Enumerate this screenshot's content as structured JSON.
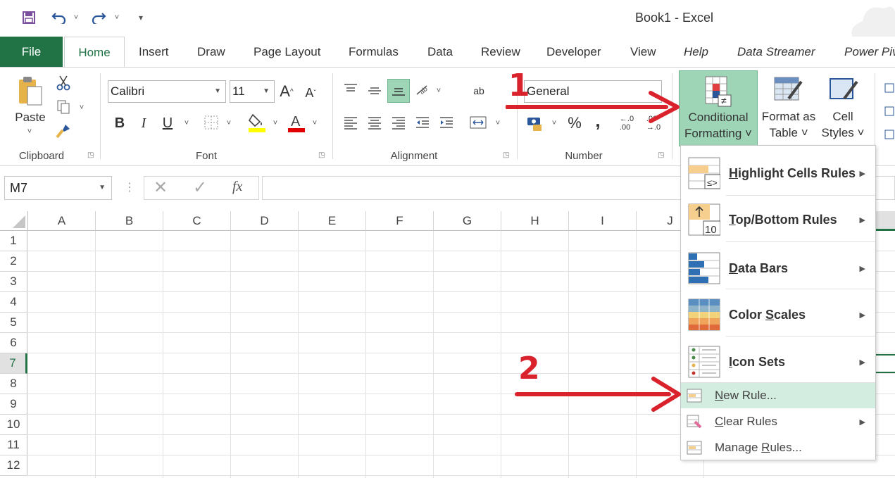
{
  "window": {
    "title": "Book1  -  Excel"
  },
  "quick_access": {
    "save": "save-icon",
    "undo": "undo-icon",
    "redo": "redo-icon",
    "customize": "customize-icon"
  },
  "tabs": [
    {
      "label": "File"
    },
    {
      "label": "Home"
    },
    {
      "label": "Insert"
    },
    {
      "label": "Draw"
    },
    {
      "label": "Page Layout"
    },
    {
      "label": "Formulas"
    },
    {
      "label": "Data"
    },
    {
      "label": "Review"
    },
    {
      "label": "Developer"
    },
    {
      "label": "View"
    },
    {
      "label": "Help"
    },
    {
      "label": "Data Streamer"
    },
    {
      "label": "Power Piv"
    }
  ],
  "clipboard": {
    "paste": "Paste",
    "group": "Clipboard"
  },
  "font": {
    "name": "Calibri",
    "size": "11",
    "bold": "B",
    "italic": "I",
    "underline": "U",
    "grow": "A",
    "shrink": "A",
    "group": "Font"
  },
  "alignment": {
    "group": "Alignment",
    "wrap": "ab"
  },
  "number": {
    "format": "General",
    "percent": "%",
    "comma": ",",
    "inc": "←.0\n.00",
    "dec": ".00\n→.0",
    "group": "Number"
  },
  "styles": {
    "conditional_formatting": [
      "Conditional",
      "Formatting ˅"
    ],
    "format_table": [
      "Format as",
      "Table ˅"
    ],
    "cell_styles": [
      "Cell",
      "Styles ˅"
    ]
  },
  "formula_bar": {
    "name_box": "M7",
    "fx": "fx",
    "value": ""
  },
  "grid": {
    "columns": [
      "A",
      "B",
      "C",
      "D",
      "E",
      "F",
      "G",
      "H",
      "I",
      "J"
    ],
    "rows": [
      "1",
      "2",
      "3",
      "4",
      "5",
      "6",
      "7",
      "8",
      "9",
      "10",
      "11",
      "12"
    ],
    "active_row": "7"
  },
  "cf_menu": {
    "items": [
      {
        "label": "Highlight Cells Rules",
        "underline": "H"
      },
      {
        "label": "Top/Bottom Rules",
        "underline": "T"
      },
      {
        "label": "Data Bars",
        "underline": "D"
      },
      {
        "label": "Color Scales",
        "underline": "S"
      },
      {
        "label": "Icon Sets",
        "underline": "I"
      },
      {
        "label": "New Rule...",
        "underline": "N"
      },
      {
        "label": "Clear Rules",
        "underline": "C"
      },
      {
        "label": "Manage Rules...",
        "underline": "R"
      }
    ],
    "top_bottom_icon_number": "10"
  },
  "annotations": {
    "step1": "1",
    "step2": "2"
  },
  "colors": {
    "excel_green": "#217346",
    "highlight": "#d3ede0",
    "arrow_red": "#d9222b",
    "ribbon_selected": "#9fd5b7"
  }
}
